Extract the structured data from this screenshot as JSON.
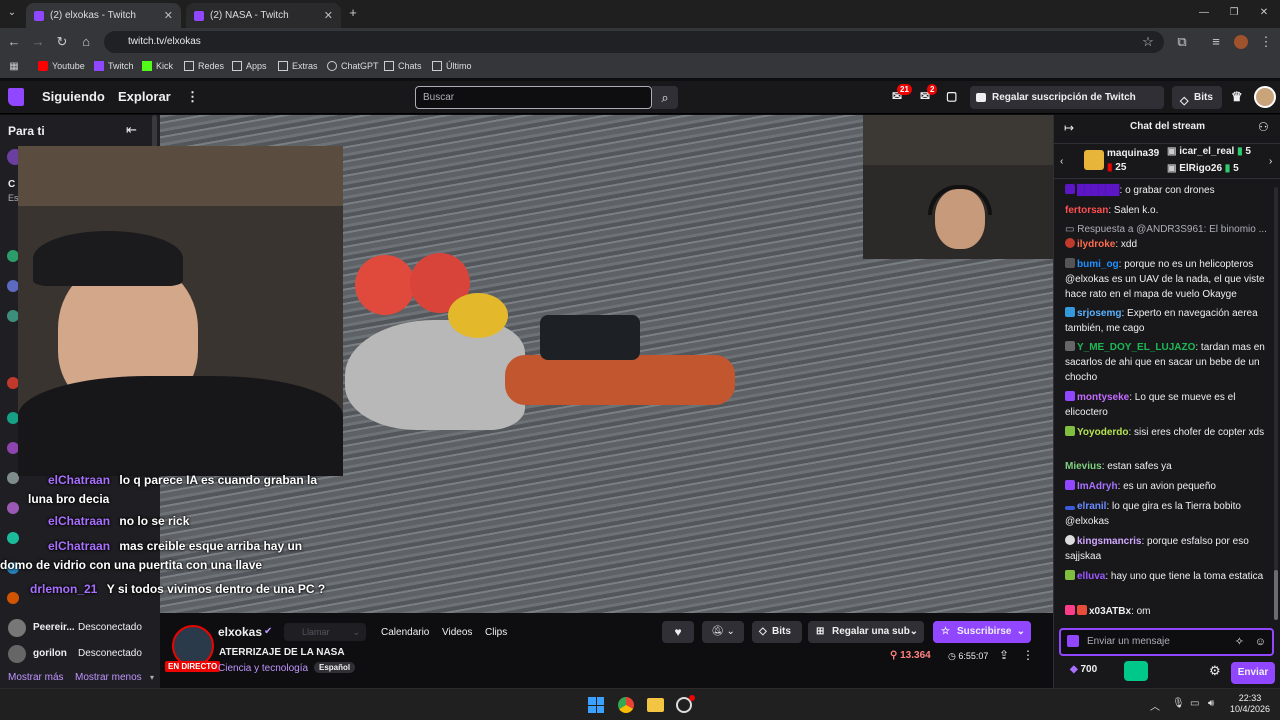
{
  "browser": {
    "tabs": [
      {
        "label": "(2) elxokas - Twitch",
        "active": true
      },
      {
        "label": "(2) NASA - Twitch",
        "active": false
      }
    ],
    "url": "twitch.tv/elxokas",
    "bookmarks": [
      "Youtube",
      "Twitch",
      "Kick",
      "Redes",
      "Apps",
      "Extras",
      "ChatGPT",
      "Chats",
      "Último"
    ]
  },
  "twitch_nav": {
    "following": "Siguiendo",
    "explore": "Explorar",
    "search_placeholder": "Buscar",
    "notif_count_1": "21",
    "notif_count_2": "2",
    "turbo_label": "Regalar suscripción de Twitch Turbo",
    "bits_label": "Bits"
  },
  "sidebar": {
    "title": "Para ti",
    "offline_users": [
      {
        "name": "Peereir...",
        "status": "Desconectado"
      },
      {
        "name": "gorilon",
        "status": "Desconectado"
      }
    ],
    "show_more": "Mostrar más",
    "show_less": "Mostrar menos"
  },
  "video_overlay_chat": [
    {
      "user": "elChatraan",
      "text": "lo q parece IA es cuando graban la luna bro decia"
    },
    {
      "user": "elChatraan",
      "text": "no lo se rick"
    },
    {
      "user": "elChatraan",
      "text": "mas creible esque arriba hay un domo de vidrio con una puertita con una llave"
    },
    {
      "user": "drlemon_21",
      "text": "Y si todos vivimos dentro de una PC ?"
    }
  ],
  "stream_info": {
    "channel": "elxokas",
    "live_badge": "EN DIRECTO",
    "follow_btn": "Llamar",
    "tabs": [
      "Calendario",
      "Videos",
      "Clips"
    ],
    "bits": "Bits",
    "gift_sub": "Regalar una sub",
    "subscribe": "Suscribirse",
    "title": "ATERRIZAJE DE LA NASA",
    "category": "Ciencia y tecnología",
    "language_tag": "Español",
    "viewers": "13.364",
    "uptime": "6:55:07"
  },
  "chat": {
    "header": "Chat del stream",
    "leaderboard": [
      {
        "name": "maquina39",
        "count": "25"
      },
      {
        "name": "icar_el_real",
        "count": "5"
      },
      {
        "name": "ElRigo26",
        "count": "5"
      }
    ],
    "messages": [
      {
        "user": "",
        "color": "#5c16c5",
        "text": ": o grabar con drones"
      },
      {
        "user": "fertorsan",
        "color": "#ff4f4f",
        "text": ": Salen k.o."
      },
      {
        "user": "",
        "color": "#adadb8",
        "text": "Respuesta a @ANDR3S961: El binomio ..."
      },
      {
        "user": "ilydroke",
        "color": "#ff6b4f",
        "text": ": xdd"
      },
      {
        "user": "bumi_og",
        "color": "#1e90ff",
        "text": ": porque no es un helicopteros @elxokas es un UAV de la nada, el que viste hace rato en el mapa de vuelo Okayge"
      },
      {
        "user": "srjosemg",
        "color": "#5ab3ff",
        "text": ": Experto en navegación aerea también, me cago"
      },
      {
        "user": "Y_ME_DOY_EL_LUJAZO",
        "color": "#1db954",
        "text": ": tardan mas en sacarlos de ahi que en sacar un bebe de un chocho"
      },
      {
        "user": "montyseke",
        "color": "#c36bff",
        "text": ": Lo que se mueve es el elicoctero"
      },
      {
        "user": "Yoyoderdo",
        "color": "#b4e34e",
        "text": ": sisi eres chofer de copter xds"
      },
      {
        "user": "Mievius",
        "color": "#7fd17f",
        "text": ": estan safes ya"
      },
      {
        "user": "ImAdryh",
        "color": "#a970ff",
        "text": ": es un avion pequeño"
      },
      {
        "user": "elranil",
        "color": "#6b8cff",
        "text": ": lo que gira es la Tierra bobito @elxokas"
      },
      {
        "user": "kingsmancris",
        "color": "#d2a8ff",
        "text": ": porque esfalso por eso sajjskaa"
      },
      {
        "user": "elluva",
        "color": "#9b59ff",
        "text": ": hay uno que tiene la toma estatica"
      },
      {
        "user": "x03ATBx",
        "color": "#efeff1",
        "text": ": om"
      }
    ],
    "input_placeholder": "Enviar un mensaje",
    "points": "700",
    "send": "Enviar"
  },
  "taskbar": {
    "time": "22:33",
    "date": "10/4/2026"
  }
}
